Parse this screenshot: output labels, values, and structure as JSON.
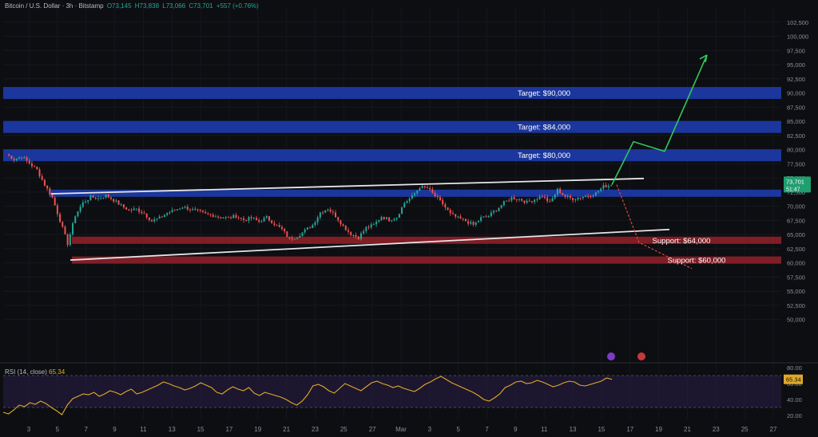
{
  "header": {
    "symbol": "Bitcoin / U.S. Dollar · 3h · Bitstamp",
    "open": "O73,145",
    "high": "H73,838",
    "low": "L73,066",
    "close": "C73,701",
    "change": "+557 (+0.76%)"
  },
  "chart_data": {
    "type": "candlestick",
    "title": "Bitcoin / U.S. Dollar · 3h · Bitstamp",
    "ylim": [
      42500,
      105000
    ],
    "y_ticks": [
      "102,500",
      "100,000",
      "97,500",
      "95,000",
      "92,500",
      "90,000",
      "87,500",
      "85,000",
      "82,500",
      "80,000",
      "77,500",
      "75,000",
      "72,500",
      "70,000",
      "67,500",
      "65,000",
      "62,500",
      "60,000",
      "57,500",
      "55,000",
      "52,500",
      "50,000"
    ],
    "x_ticks": [
      "3",
      "5",
      "7",
      "9",
      "11",
      "13",
      "15",
      "17",
      "19",
      "21",
      "23",
      "25",
      "27",
      "Mar",
      "3",
      "5",
      "7",
      "9",
      "11",
      "13",
      "15",
      "17",
      "19",
      "21",
      "23",
      "25",
      "27"
    ],
    "price_path": [
      79200,
      78300,
      78800,
      77600,
      76400,
      73800,
      71500,
      67500,
      63400,
      68400,
      70600,
      71600,
      71400,
      71900,
      71100,
      70100,
      69300,
      69500,
      68700,
      67400,
      67900,
      68800,
      69300,
      69900,
      69500,
      69100,
      68600,
      68400,
      68100,
      67900,
      68300,
      67600,
      67900,
      67300,
      68000,
      66900,
      65900,
      64200,
      64700,
      65700,
      66700,
      68900,
      69600,
      68300,
      66500,
      65100,
      64500,
      66200,
      66700,
      68200,
      67600,
      68100,
      70600,
      71700,
      73400,
      73200,
      71800,
      70400,
      68600,
      67900,
      67400,
      66700,
      67900,
      68300,
      69400,
      70600,
      71500,
      71300,
      70700,
      71200,
      71800,
      70600,
      72900,
      71700,
      71300,
      71600,
      71900,
      72300,
      73500,
      73701
    ],
    "current_price": "73,701",
    "current_countdown": "51:47",
    "zones": [
      {
        "label": "Target: $90,000",
        "price": 90000,
        "kind": "resistance",
        "color": "#1c3aa8"
      },
      {
        "label": "Target: $84,000",
        "price": 84000,
        "kind": "resistance",
        "color": "#1c3aa8"
      },
      {
        "label": "Target: $80,000",
        "price": 79000,
        "kind": "resistance",
        "color": "#1c3aa8"
      },
      {
        "label": "",
        "price": 72300,
        "kind": "pivot",
        "color": "#1c3aa8"
      },
      {
        "label": "Support: $64,000",
        "price": 64000,
        "kind": "support",
        "color": "#8a1f28"
      },
      {
        "label": "Support: $60,000",
        "price": 60500,
        "kind": "support",
        "color": "#8a1f28"
      }
    ],
    "trendlines": [
      {
        "name": "upper-channel",
        "from": [
          72200,
          0.0
        ],
        "to": [
          74900,
          1.0
        ]
      },
      {
        "name": "lower-channel",
        "from": [
          60500,
          0.0
        ],
        "to": [
          65900,
          1.0
        ]
      }
    ],
    "projections": {
      "bullish": [
        73800,
        81400,
        79700,
        96700
      ],
      "bearish": [
        73800,
        63600,
        59000
      ]
    },
    "rsi": {
      "label": "RSI (14, close)",
      "value": "65.34",
      "ylim": [
        15,
        85
      ],
      "ticks": [
        "80.00",
        "60.00",
        "40.00",
        "20.00"
      ],
      "band": [
        30,
        70
      ],
      "values": [
        24,
        22,
        27,
        33,
        31,
        36,
        34,
        38,
        35,
        30,
        26,
        21,
        33,
        41,
        44,
        47,
        46,
        49,
        44,
        47,
        51,
        49,
        46,
        50,
        53,
        47,
        49,
        52,
        55,
        58,
        62,
        60,
        57,
        55,
        52,
        54,
        57,
        61,
        58,
        55,
        49,
        47,
        52,
        56,
        53,
        51,
        55,
        48,
        45,
        49,
        47,
        45,
        43,
        40,
        36,
        33,
        38,
        46,
        57,
        59,
        56,
        51,
        48,
        54,
        60,
        57,
        54,
        51,
        56,
        61,
        63,
        60,
        58,
        55,
        57,
        54,
        52,
        50,
        54,
        59,
        62,
        66,
        69,
        65,
        61,
        58,
        55,
        52,
        49,
        45,
        40,
        38,
        42,
        47,
        55,
        58,
        62,
        63,
        60,
        61,
        64,
        62,
        59,
        56,
        58,
        61,
        63,
        62,
        58,
        57,
        59,
        61,
        63,
        67,
        65.34
      ]
    }
  }
}
